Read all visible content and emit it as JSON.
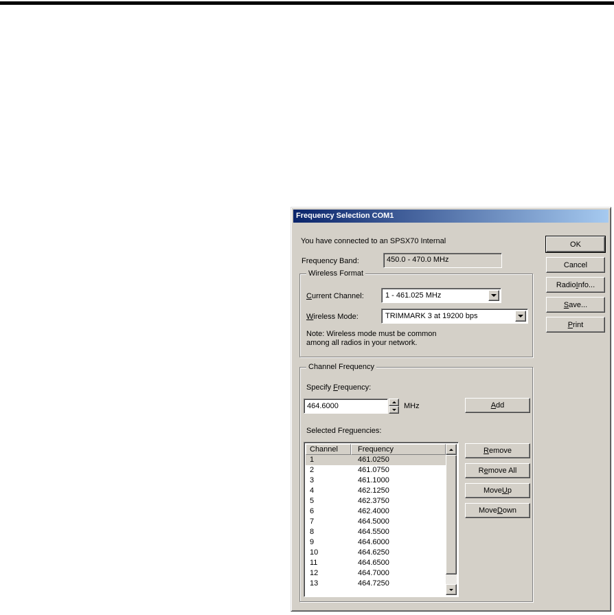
{
  "dialog": {
    "title": "Frequency Selection COM1",
    "intro": "You have connected to an SPSX70 Internal",
    "frequency_band": {
      "label": "Frequency Band:",
      "value": "450.0 - 470.0 MHz"
    },
    "wireless_format": {
      "title": "Wireless Format",
      "current_channel": {
        "label": "&Current Channel:",
        "value": "1 - 461.025 MHz"
      },
      "wireless_mode": {
        "label": "&Wireless Mode:",
        "value": "TRIMMARK 3 at 19200 bps"
      },
      "note_line1": "Note: Wireless mode must be common",
      "note_line2": "among all radios in your network."
    },
    "channel_frequency": {
      "title": "Channel Frequency",
      "specify_frequency_label": "Specify &Frequency:",
      "frequency_value": "464.6000",
      "unit": "MHz",
      "add_label": "&Add",
      "selected_frequencies_label": "Selected Fre&quencies:",
      "remove_label": "&Remove",
      "remove_all_label": "R&emove All",
      "move_up_label": "Move &Up",
      "move_down_label": "Move &Down",
      "list": {
        "columns": [
          "Channel",
          "Frequency"
        ],
        "rows": [
          {
            "channel": "1",
            "frequency": "461.0250",
            "selected": true
          },
          {
            "channel": "2",
            "frequency": "461.0750",
            "selected": false
          },
          {
            "channel": "3",
            "frequency": "461.1000",
            "selected": false
          },
          {
            "channel": "4",
            "frequency": "462.1250",
            "selected": false
          },
          {
            "channel": "5",
            "frequency": "462.3750",
            "selected": false
          },
          {
            "channel": "6",
            "frequency": "462.4000",
            "selected": false
          },
          {
            "channel": "7",
            "frequency": "464.5000",
            "selected": false
          },
          {
            "channel": "8",
            "frequency": "464.5500",
            "selected": false
          },
          {
            "channel": "9",
            "frequency": "464.6000",
            "selected": false
          },
          {
            "channel": "10",
            "frequency": "464.6250",
            "selected": false
          },
          {
            "channel": "11",
            "frequency": "464.6500",
            "selected": false
          },
          {
            "channel": "12",
            "frequency": "464.7000",
            "selected": false
          },
          {
            "channel": "13",
            "frequency": "464.7250",
            "selected": false
          }
        ]
      }
    },
    "buttons": {
      "ok": "OK",
      "cancel": "Cancel",
      "radio_info": "Radio &Info...",
      "save": "&Save...",
      "print": "&Print"
    },
    "colors": {
      "dialog_face": "#D4D0C8",
      "title_gradient_start": "#0A246A",
      "title_gradient_end": "#A6CAF0",
      "selection_unfocused": "#D4D0C8"
    }
  }
}
